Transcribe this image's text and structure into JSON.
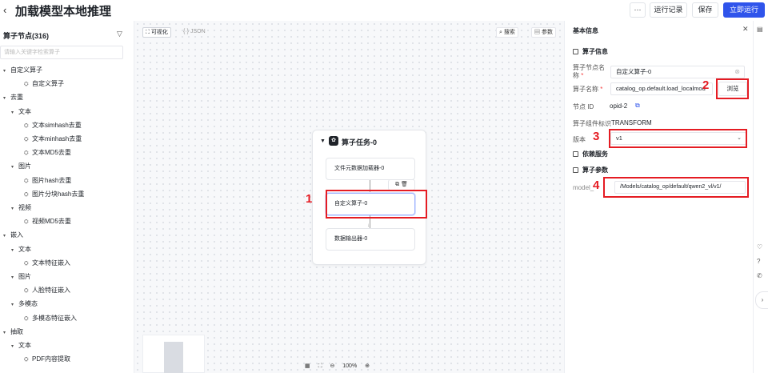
{
  "header": {
    "back_glyph": "‹",
    "title": "加载模型本地推理",
    "more_label": "···",
    "history_label": "运行记录",
    "save_label": "保存",
    "run_label": "立即运行"
  },
  "sidebar": {
    "title": "算子节点(316)",
    "search_placeholder": "请输入关键字检索算子",
    "items": [
      {
        "label": "自定义算子",
        "level": 0,
        "type": "group"
      },
      {
        "label": "自定义算子",
        "level": 2,
        "type": "leaf"
      },
      {
        "label": "去重",
        "level": 0,
        "type": "group"
      },
      {
        "label": "文本",
        "level": 1,
        "type": "group"
      },
      {
        "label": "文本simhash去重",
        "level": 2,
        "type": "leaf"
      },
      {
        "label": "文本minhash去重",
        "level": 2,
        "type": "leaf"
      },
      {
        "label": "文本MD5去重",
        "level": 2,
        "type": "leaf"
      },
      {
        "label": "图片",
        "level": 1,
        "type": "group"
      },
      {
        "label": "图片hash去重",
        "level": 2,
        "type": "leaf"
      },
      {
        "label": "图片分块hash去重",
        "level": 2,
        "type": "leaf"
      },
      {
        "label": "视频",
        "level": 1,
        "type": "group"
      },
      {
        "label": "视频MD5去重",
        "level": 2,
        "type": "leaf"
      },
      {
        "label": "嵌入",
        "level": 0,
        "type": "group"
      },
      {
        "label": "文本",
        "level": 1,
        "type": "group"
      },
      {
        "label": "文本特征嵌入",
        "level": 2,
        "type": "leaf"
      },
      {
        "label": "图片",
        "level": 1,
        "type": "group"
      },
      {
        "label": "人脸特征嵌入",
        "level": 2,
        "type": "leaf"
      },
      {
        "label": "多模态",
        "level": 1,
        "type": "group"
      },
      {
        "label": "多模态特征嵌入",
        "level": 2,
        "type": "leaf"
      },
      {
        "label": "抽取",
        "level": 0,
        "type": "group"
      },
      {
        "label": "文本",
        "level": 1,
        "type": "group"
      },
      {
        "label": "PDF内容提取",
        "level": 2,
        "type": "leaf"
      }
    ]
  },
  "canvas": {
    "view_visual": "可视化",
    "view_json": "JSON",
    "search_label": "搜索",
    "params_label": "参数",
    "task_name": "算子任务-0",
    "nodes": [
      "文件元数据加载器-0",
      "自定义算子-0",
      "数据输出器-0"
    ],
    "zoom": "100%"
  },
  "panel": {
    "title": "基本信息",
    "section_operator": "算子信息",
    "node_name_label": "算子节点名称",
    "node_name_value": "自定义算子-0",
    "op_name_label": "算子名称",
    "op_name_value": "catalog_op.default.load_localmod",
    "browse_label": "浏览",
    "node_id_label": "节点 ID",
    "node_id_value": "opid-2",
    "component_label": "算子组件标识",
    "component_value": "TRANSFORM",
    "version_label": "版本",
    "version_value": "v1",
    "section_deps": "依赖服务",
    "section_params": "算子参数",
    "model_label": "model_",
    "model_value": "/Models/catalog_op/default/qwen2_vl/v1/"
  },
  "annotations": [
    "1",
    "2",
    "3",
    "4"
  ],
  "colors": {
    "accent": "#2f54eb",
    "annotation": "#e51c23"
  }
}
